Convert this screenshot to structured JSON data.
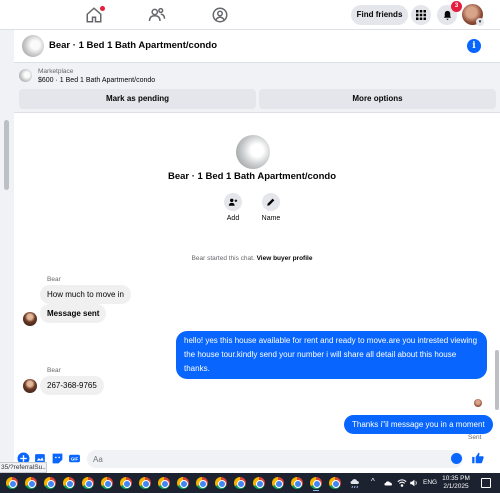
{
  "topnav": {
    "find_friends": "Find friends",
    "notification_count": "3"
  },
  "chat_header": {
    "title": "Bear · 1 Bed 1 Bath Apartment/condo"
  },
  "marketplace": {
    "label": "Marketplace",
    "price_line": "$600 · 1 Bed 1 Bath Apartment/condo",
    "mark_pending": "Mark as pending",
    "more_options": "More options"
  },
  "listing": {
    "title": "Bear · 1 Bed 1 Bath Apartment/condo",
    "actions": [
      {
        "label": "Add",
        "icon": "add-person-icon"
      },
      {
        "label": "Name",
        "icon": "pencil-icon"
      }
    ],
    "started_text": "Bear started this chat.",
    "view_profile": "View buyer profile"
  },
  "messages": [
    {
      "sender": "Bear",
      "text": "How much to move in",
      "direction": "incoming"
    },
    {
      "sender": "",
      "text": "Message sent",
      "direction": "incoming"
    },
    {
      "sender": "",
      "text": "hello! yes this house available for rent and ready to move.are you intrested viewing the house tour.kindly send your number i will share all detail about this house thanks.",
      "direction": "outgoing"
    },
    {
      "sender": "Bear",
      "text": "267-368-9765",
      "direction": "incoming"
    },
    {
      "sender": "",
      "text": "Thanks i\"il message you in a moment",
      "direction": "outgoing"
    }
  ],
  "sent_status": "Sent",
  "composer": {
    "placeholder": "Aa"
  },
  "status_url": "35/?referralSu...",
  "taskbar": {
    "language": "ENG",
    "time": "10:35 PM",
    "date": "2/1/2025"
  },
  "colors": {
    "accent": "#0866ff",
    "bubble_in": "#f0f0f0",
    "badge": "#e41e3f"
  }
}
